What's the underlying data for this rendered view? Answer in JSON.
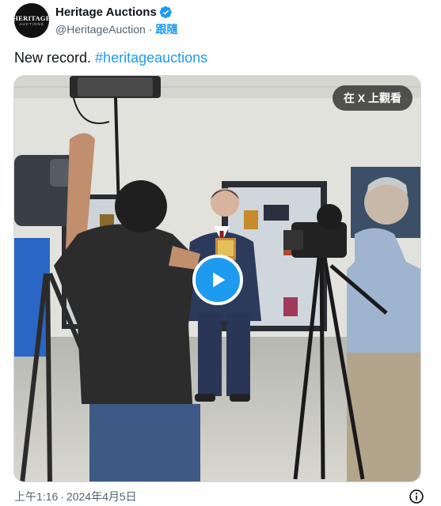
{
  "account": {
    "avatar_logo_main": "HERITAGE",
    "avatar_logo_sub": "AUCTIONS",
    "display_name": "Heritage Auctions",
    "handle": "@HeritageAuction",
    "separator": "·",
    "follow_label": "跟隨",
    "verified_icon": "verified-badge-icon",
    "verified_color": "#1d9bf0"
  },
  "tweet": {
    "text": "New record.",
    "hashtag": "#heritageauctions"
  },
  "media": {
    "type": "video",
    "watch_on_x_label": "在 X 上觀看",
    "play_icon": "play-icon",
    "accent_color": "#1d9bf0"
  },
  "footer": {
    "time": "上午1:16",
    "separator": "·",
    "date": "2024年4月5日",
    "info_icon": "info-icon"
  }
}
